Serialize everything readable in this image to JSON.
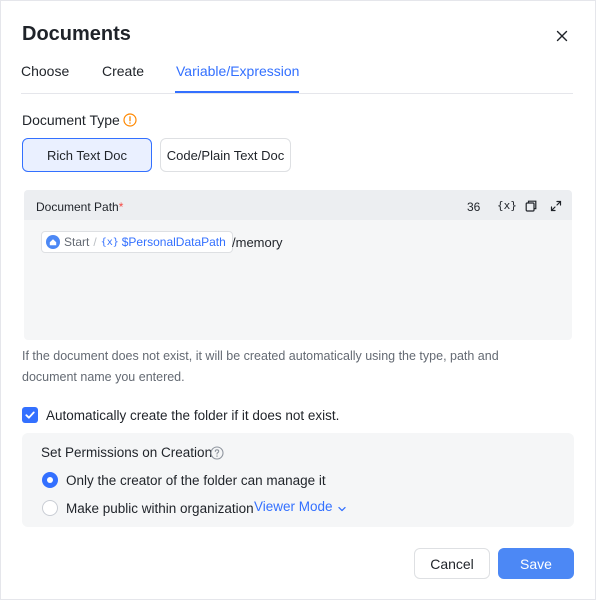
{
  "dialog": {
    "title": "Documents",
    "tabs": [
      {
        "label": "Choose",
        "active": false
      },
      {
        "label": "Create",
        "active": false
      },
      {
        "label": "Variable/Expression",
        "active": true
      }
    ]
  },
  "document_type": {
    "label": "Document Type",
    "options": [
      {
        "label": "Rich Text Doc",
        "selected": true
      },
      {
        "label": "Code/Plain Text Doc",
        "selected": false
      }
    ]
  },
  "document_path": {
    "label": "Document Path",
    "required_mark": "*",
    "char_count": "36",
    "variable_button": "{x}",
    "chip": {
      "node": "Start",
      "separator": "/",
      "variable_icon": "{x}",
      "variable": "$PersonalDataPath"
    },
    "suffix": "/memory"
  },
  "hint": "If the document does not exist, it will be created automatically using the type, path and document name you entered.",
  "auto_create_folder": {
    "label": "Automatically create the folder if it does not exist.",
    "checked": true
  },
  "permissions": {
    "title": "Set Permissions on Creation",
    "options": [
      {
        "label": "Only the creator of the folder can manage it",
        "selected": true
      },
      {
        "label": "Make public within organization",
        "selected": false
      }
    ],
    "viewer_mode": "Viewer Mode"
  },
  "actions": {
    "cancel": "Cancel",
    "save": "Save"
  },
  "colors": {
    "accent": "#3370ff",
    "save_button": "#4c88f5",
    "warning": "#ff8800",
    "required": "#f54a45"
  }
}
